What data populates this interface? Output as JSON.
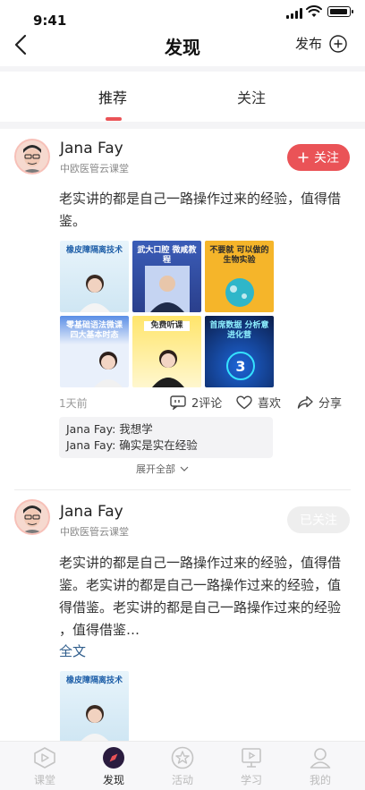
{
  "status_bar": {
    "time": "9:41"
  },
  "header": {
    "title": "发现",
    "publish_label": "发布"
  },
  "tabs": [
    {
      "label": "推荐",
      "active": true
    },
    {
      "label": "关注",
      "active": false
    }
  ],
  "posts": [
    {
      "author": "Jana Fay",
      "org": "中欧医管云课堂",
      "follow_label": "关注",
      "text": "老实讲的都是自己一路操作过来的经验，值得借鉴。",
      "images": [
        {
          "title": "橡皮障隔离技术"
        },
        {
          "title": "武大口腔 微咸教程"
        },
        {
          "title": "不要就 可以做的 生物实验"
        },
        {
          "title": "零基础语法微课 四大基本时态"
        },
        {
          "title": "免费听课"
        },
        {
          "title": "首席数据 分析意进化营"
        }
      ],
      "time_ago": "1天前",
      "comments_label": "2评论",
      "like_label": "喜欢",
      "share_label": "分享",
      "comments": [
        "Jana Fay: 我想学",
        "Jana Fay: 确实是实在经验"
      ],
      "expand_label": "展开全部"
    },
    {
      "author": "Jana Fay",
      "org": "中欧医管云课堂",
      "follow_label": "已关注",
      "text_lines": [
        "老实讲的都是自己一路操作过来的经验，值得借",
        "鉴。老实讲的都是自己一路操作过来的经验，值",
        "得借鉴。老实讲的都是自己一路操作过来的经验",
        "，值得借鉴…"
      ],
      "fulltext_label": "全文",
      "images": [
        {
          "title": "橡皮障隔离技术"
        }
      ]
    }
  ],
  "bottom_nav": [
    {
      "label": "课堂",
      "icon": "classroom-icon",
      "active": false
    },
    {
      "label": "发现",
      "icon": "discover-icon",
      "active": true
    },
    {
      "label": "活动",
      "icon": "activity-icon",
      "active": false
    },
    {
      "label": "学习",
      "icon": "study-icon",
      "active": false
    },
    {
      "label": "我的",
      "icon": "profile-icon",
      "active": false
    }
  ],
  "colors": {
    "accent": "#ea5357",
    "link": "#2f5d8c",
    "divider": "#f4f4f6"
  }
}
